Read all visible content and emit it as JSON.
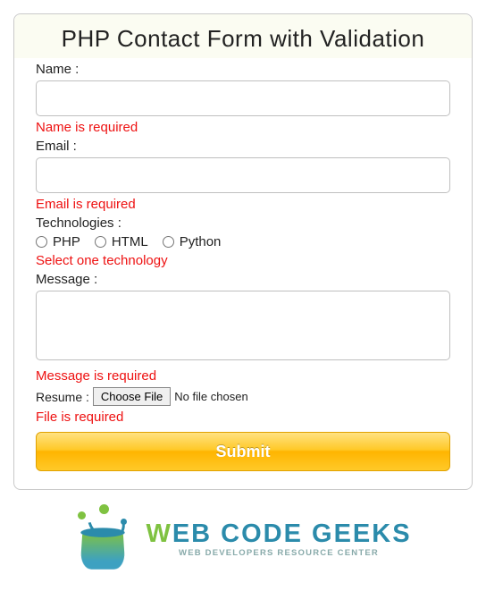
{
  "form": {
    "title": "PHP Contact Form with Validation",
    "name": {
      "label": "Name :",
      "value": "",
      "error": "Name is required"
    },
    "email": {
      "label": "Email :",
      "value": "",
      "error": "Email is required"
    },
    "technologies": {
      "label": "Technologies :",
      "options": [
        "PHP",
        "HTML",
        "Python"
      ],
      "error": "Select one technology"
    },
    "message": {
      "label": "Message :",
      "value": "",
      "error": "Message is required"
    },
    "resume": {
      "label": "Resume :",
      "button": "Choose File",
      "status": "No file chosen",
      "error": "File is required"
    },
    "submit": "Submit"
  },
  "logo": {
    "main_w": "W",
    "main_rest": "EB CODE GEEKS",
    "sub": "WEB DEVELOPERS RESOURCE CENTER"
  }
}
